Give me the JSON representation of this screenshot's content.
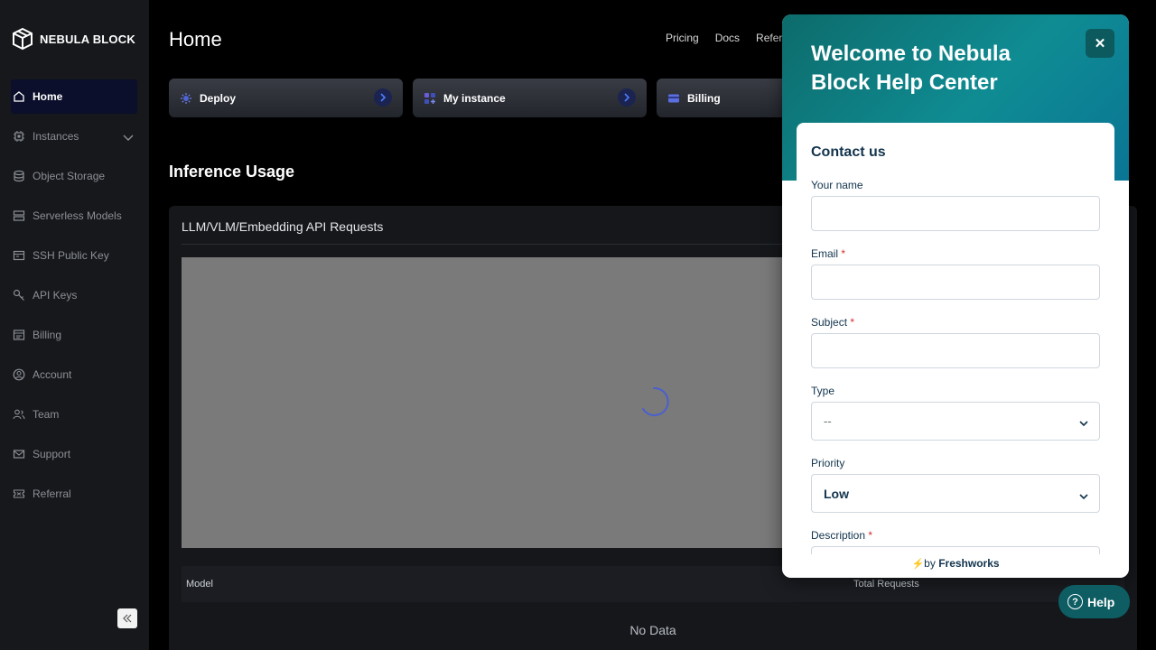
{
  "brand": {
    "name": "NEBULA BLOCK"
  },
  "sidebar": {
    "items": [
      {
        "label": "Home",
        "icon": "home-icon",
        "active": true
      },
      {
        "label": "Instances",
        "icon": "chip-icon",
        "expandable": true
      },
      {
        "label": "Object Storage",
        "icon": "database-icon"
      },
      {
        "label": "Serverless Models",
        "icon": "server-icon"
      },
      {
        "label": "SSH Public Key",
        "icon": "ssh-key-icon"
      },
      {
        "label": "API Keys",
        "icon": "key-icon"
      },
      {
        "label": "Billing",
        "icon": "billing-icon"
      },
      {
        "label": "Account",
        "icon": "user-circle-icon"
      },
      {
        "label": "Team",
        "icon": "team-icon"
      },
      {
        "label": "Support",
        "icon": "mail-icon"
      },
      {
        "label": "Referral",
        "icon": "ticket-icon"
      }
    ]
  },
  "header": {
    "title": "Home",
    "links": [
      "Pricing",
      "Docs",
      "Referr"
    ]
  },
  "cards": [
    {
      "label": "Deploy",
      "icon": "deploy-icon"
    },
    {
      "label": "My instance",
      "icon": "grid-icon"
    },
    {
      "label": "Billing",
      "icon": "card-icon"
    }
  ],
  "usage": {
    "section_title": "Inference Usage",
    "panel_title": "LLM/VLM/Embedding API Requests",
    "columns": [
      "Model",
      "Total Requests"
    ],
    "empty_text": "No Data"
  },
  "help_widget": {
    "title": "Welcome to Nebula Block Help Center",
    "form_heading": "Contact us",
    "fields": {
      "name_label": "Your name",
      "email_label": "Email",
      "subject_label": "Subject",
      "type_label": "Type",
      "type_value": "--",
      "priority_label": "Priority",
      "priority_value": "Low",
      "description_label": "Description",
      "required_mark": "*"
    },
    "footer_prefix": "by",
    "footer_brand": "Freshworks",
    "help_button": "Help",
    "help_glyph": "?",
    "close_glyph": "✕"
  },
  "colors": {
    "sidebar_bg": "#16181c",
    "active_bg": "#0b0f2b",
    "widget_teal": "#0f8c93",
    "help_button_bg": "#0d5d62",
    "required": "#d72d30"
  }
}
